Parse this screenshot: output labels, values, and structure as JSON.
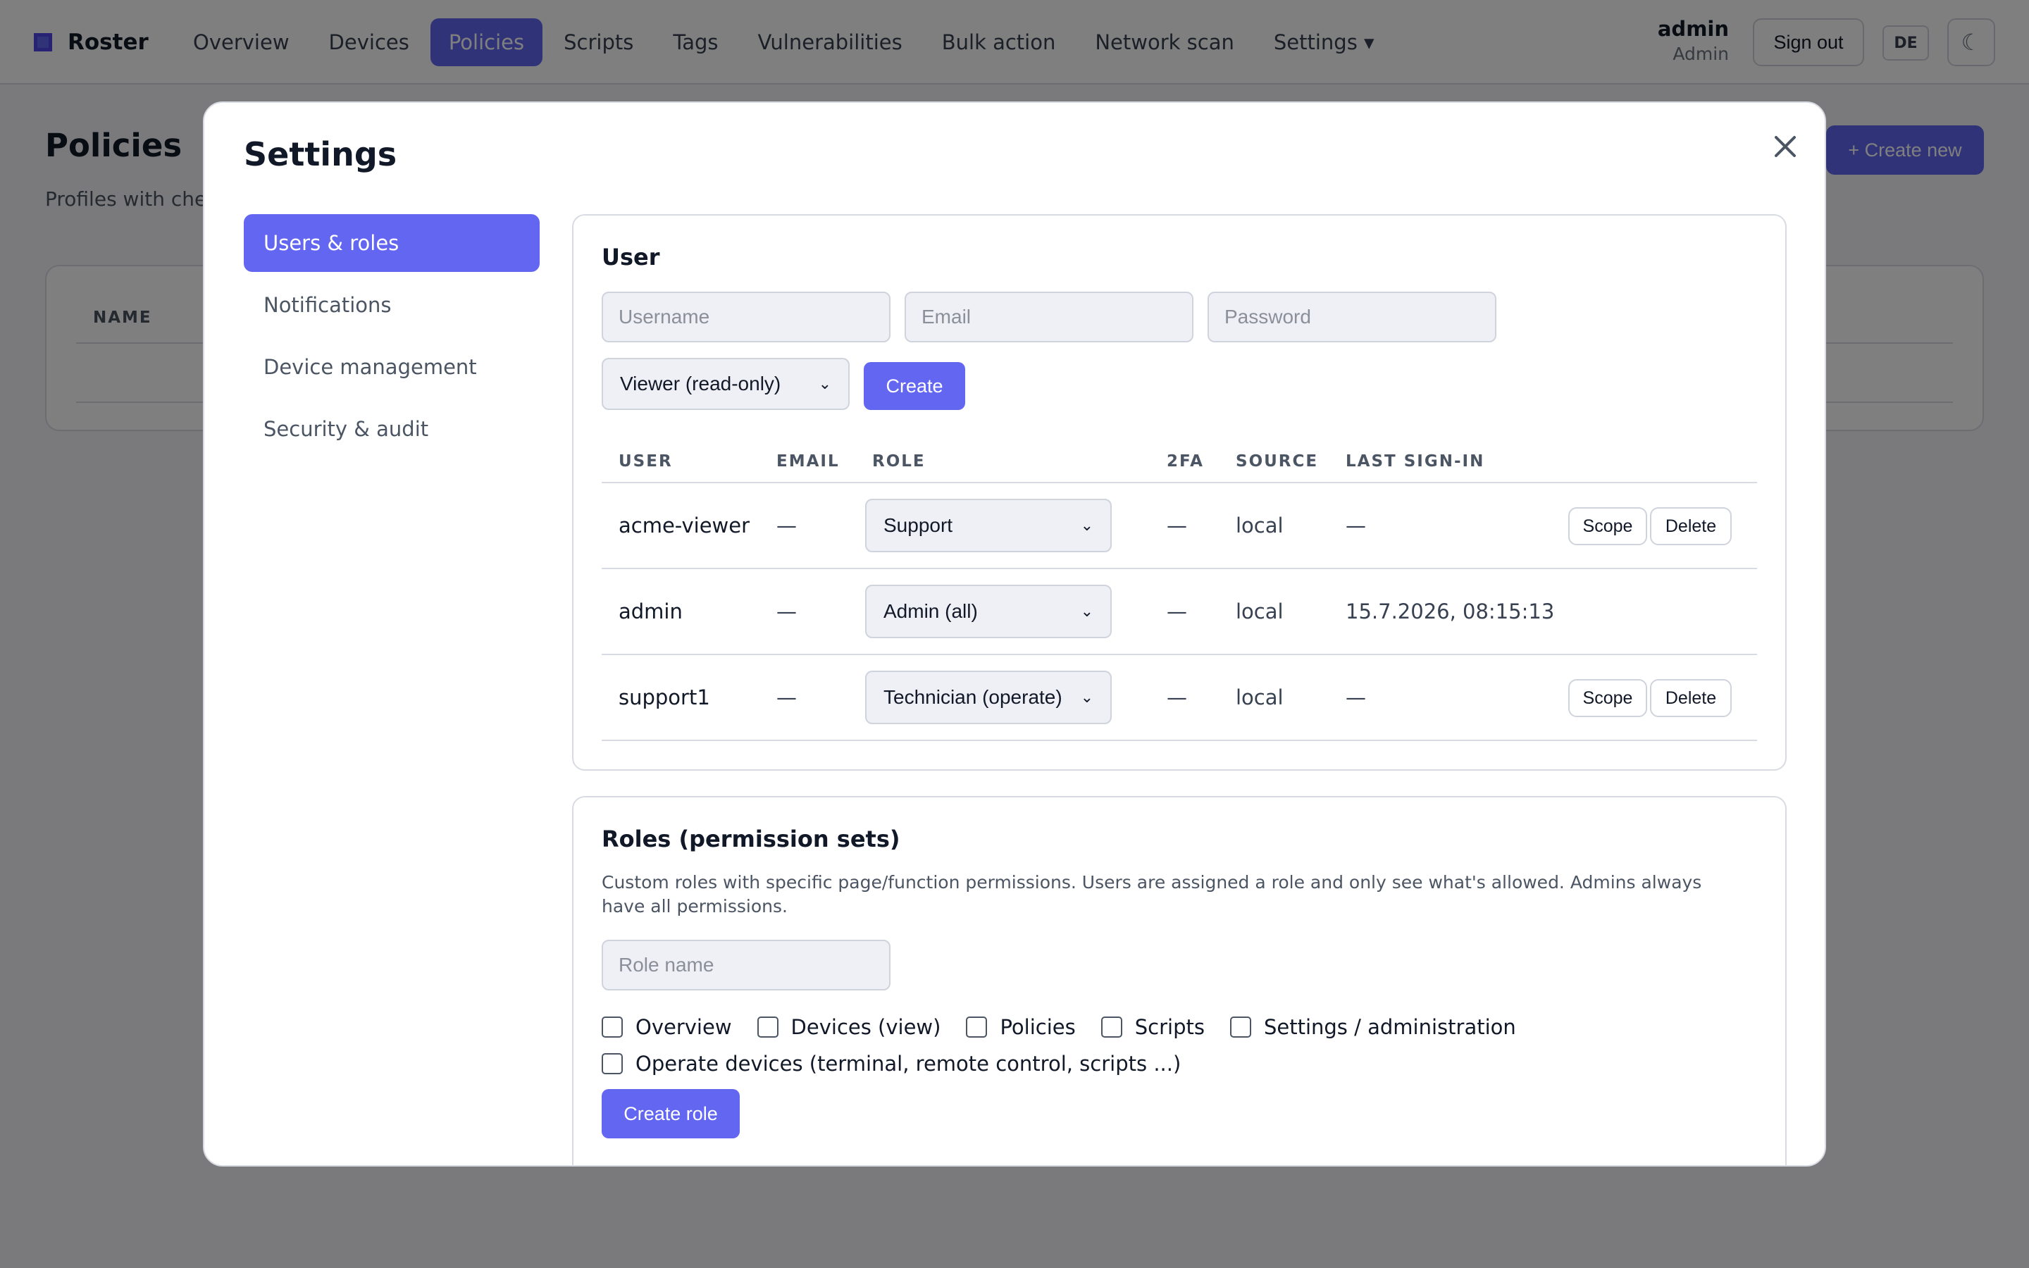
{
  "app": {
    "brand": "Roster",
    "nav": [
      "Overview",
      "Devices",
      "Policies",
      "Scripts",
      "Tags",
      "Vulnerabilities",
      "Bulk action",
      "Network scan",
      "Settings ▾"
    ],
    "active_nav": "Policies",
    "user": {
      "name": "admin",
      "role": "Admin"
    },
    "sign_out": "Sign out",
    "lang": "DE",
    "theme_icon": "☾"
  },
  "page": {
    "title": "Policies",
    "subtitle": "Profiles with chec",
    "create_new": "+ Create new",
    "table_head": "NAME"
  },
  "modal": {
    "title": "Settings",
    "close": "✕",
    "menu": [
      "Users & roles",
      "Notifications",
      "Device management",
      "Security & audit"
    ],
    "active_menu": "Users & roles",
    "user_panel": {
      "title": "User",
      "username_placeholder": "Username",
      "email_placeholder": "Email",
      "password_placeholder": "Password",
      "role_select": "Viewer (read-only)",
      "create": "Create",
      "columns": [
        "USER",
        "EMAIL",
        "ROLE",
        "2FA",
        "SOURCE",
        "LAST SIGN-IN"
      ],
      "rows": [
        {
          "user": "acme-viewer",
          "email": "—",
          "role": "Support",
          "twofa": "—",
          "source": "local",
          "last_sign_in": "—",
          "scope": "Scope",
          "delete": "Delete"
        },
        {
          "user": "admin",
          "email": "—",
          "role": "Admin (all)",
          "twofa": "—",
          "source": "local",
          "last_sign_in": "15.7.2026, 08:15:13"
        },
        {
          "user": "support1",
          "email": "—",
          "role": "Technician (operate)",
          "twofa": "—",
          "source": "local",
          "last_sign_in": "—",
          "scope": "Scope",
          "delete": "Delete"
        }
      ]
    },
    "roles_panel": {
      "title": "Roles (permission sets)",
      "description": "Custom roles with specific page/function permissions. Users are assigned a role and only see what's allowed. Admins always have all permissions.",
      "role_name_placeholder": "Role name",
      "permissions": [
        "Overview",
        "Devices (view)",
        "Policies",
        "Scripts",
        "Settings / administration",
        "Operate devices (terminal, remote control, scripts ...)"
      ],
      "create_role": "Create role"
    }
  }
}
